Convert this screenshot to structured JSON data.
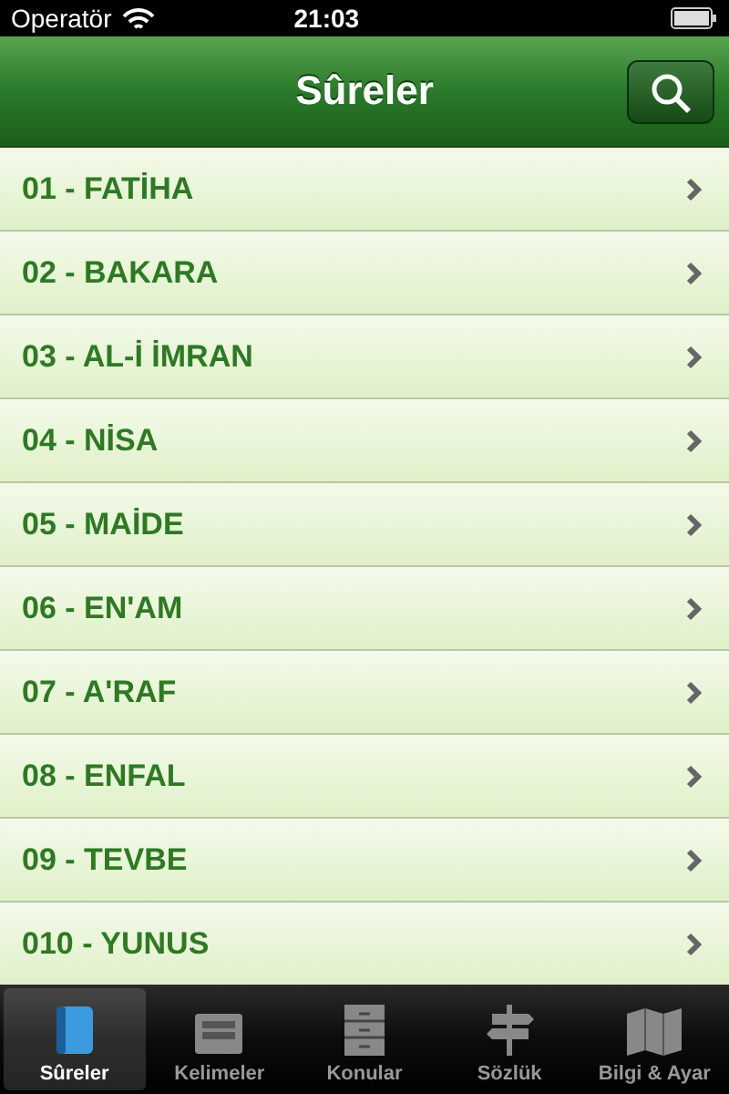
{
  "status_bar": {
    "carrier": "Operatör",
    "time": "21:03"
  },
  "nav": {
    "title": "Sûreler"
  },
  "rows": [
    {
      "label": "01 - FATİHA"
    },
    {
      "label": "02 - BAKARA"
    },
    {
      "label": "03 - AL-İ İMRAN"
    },
    {
      "label": "04 - NİSA"
    },
    {
      "label": "05 - MAİDE"
    },
    {
      "label": "06 - EN'AM"
    },
    {
      "label": "07 - A'RAF"
    },
    {
      "label": "08 - ENFAL"
    },
    {
      "label": "09 - TEVBE"
    },
    {
      "label": "010 - YUNUS"
    }
  ],
  "tabs": [
    {
      "label": "Sûreler",
      "kind": "book",
      "selected": true
    },
    {
      "label": "Kelimeler",
      "kind": "tray",
      "selected": false
    },
    {
      "label": "Konular",
      "kind": "cabinet",
      "selected": false
    },
    {
      "label": "Sözlük",
      "kind": "signpost",
      "selected": false
    },
    {
      "label": "Bilgi & Ayar",
      "kind": "map",
      "selected": false
    }
  ]
}
